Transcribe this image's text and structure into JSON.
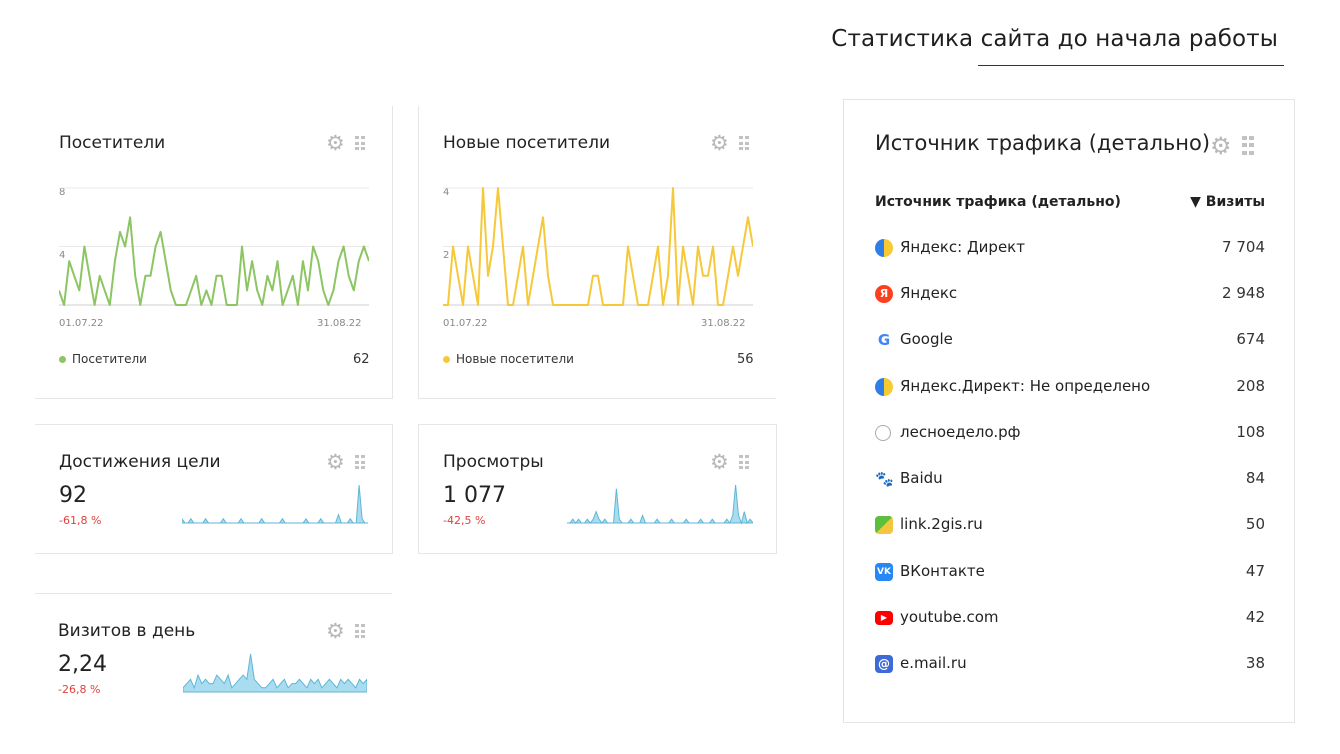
{
  "page": {
    "title": "Статистика сайта до начала работы"
  },
  "widgets": {
    "visitors": {
      "title": "Посетители",
      "y_ticks": [
        "8",
        "4"
      ],
      "x_start": "01.07.22",
      "x_end": "31.08.22",
      "legend_label": "Посетители",
      "legend_value": "62",
      "color": "#8cc563"
    },
    "new_visitors": {
      "title": "Новые посетители",
      "y_ticks": [
        "4",
        "2"
      ],
      "x_start": "01.07.22",
      "x_end": "31.08.22",
      "legend_label": "Новые посетители",
      "legend_value": "56",
      "color": "#f5c93a"
    },
    "goals": {
      "title": "Достижения цели",
      "value": "92",
      "change": "-61,8 %"
    },
    "views": {
      "title": "Просмотры",
      "value": "1 077",
      "change": "-42,5 %"
    },
    "visits_per_day": {
      "title": "Визитов в день",
      "value": "2,24",
      "change": "-26,8 %"
    }
  },
  "traffic": {
    "title": "Источник трафика (детально)",
    "col_source": "Источник трафика (детально)",
    "col_visits": "▼ Визиты",
    "rows": [
      {
        "name": "Яндекс: Директ",
        "value": "7 704",
        "icon": "yandex-direct-icon"
      },
      {
        "name": "Яндекс",
        "value": "2 948",
        "icon": "yandex-icon"
      },
      {
        "name": "Google",
        "value": "674",
        "icon": "google-icon"
      },
      {
        "name": "Яндекс.Директ: Не определено",
        "value": "208",
        "icon": "yandex-direct-icon"
      },
      {
        "name": "лесноеделo.рф",
        "value": "108",
        "icon": "globe-icon"
      },
      {
        "name": "Baidu",
        "value": "84",
        "icon": "baidu-icon"
      },
      {
        "name": "link.2gis.ru",
        "value": "50",
        "icon": "2gis-icon"
      },
      {
        "name": "ВКонтакте",
        "value": "47",
        "icon": "vk-icon"
      },
      {
        "name": "youtube.com",
        "value": "42",
        "icon": "youtube-icon"
      },
      {
        "name": "e.mail.ru",
        "value": "38",
        "icon": "mail-icon"
      }
    ]
  },
  "chart_data": [
    {
      "type": "line",
      "series": [
        {
          "name": "Посетители",
          "values": [
            1,
            0,
            3,
            2,
            1,
            4,
            2,
            0,
            2,
            1,
            0,
            3,
            5,
            4,
            6,
            2,
            0,
            2,
            2,
            4,
            5,
            3,
            1,
            0,
            0,
            0,
            1,
            2,
            0,
            1,
            0,
            2,
            2,
            0,
            0,
            0,
            4,
            1,
            3,
            1,
            0,
            2,
            1,
            3,
            0,
            1,
            2,
            0,
            3,
            1,
            4,
            3,
            1,
            0,
            1,
            3,
            4,
            2,
            1,
            3,
            4,
            3
          ]
        }
      ],
      "x_start": "01.07.22",
      "x_end": "31.08.22",
      "ylim": [
        0,
        8
      ]
    },
    {
      "type": "line",
      "series": [
        {
          "name": "Новые посетители",
          "values": [
            0,
            0,
            2,
            1,
            0,
            2,
            1,
            0,
            4,
            1,
            2,
            4,
            2,
            0,
            0,
            1,
            2,
            0,
            1,
            2,
            3,
            1,
            0,
            0,
            0,
            0,
            0,
            0,
            0,
            0,
            1,
            1,
            0,
            0,
            0,
            0,
            0,
            2,
            1,
            0,
            0,
            0,
            1,
            2,
            0,
            1,
            4,
            0,
            2,
            1,
            0,
            2,
            1,
            1,
            2,
            0,
            0,
            1,
            2,
            1,
            2,
            3,
            2
          ]
        }
      ],
      "x_start": "01.07.22",
      "x_end": "31.08.22",
      "ylim": [
        0,
        4
      ]
    },
    {
      "type": "area",
      "values": [
        1,
        0,
        0,
        1,
        0,
        0,
        0,
        0,
        1,
        0,
        0,
        0,
        0,
        0,
        1,
        0,
        0,
        0,
        0,
        0,
        1,
        0,
        0,
        0,
        0,
        0,
        0,
        1,
        0,
        0,
        0,
        0,
        0,
        0,
        1,
        0,
        0,
        0,
        0,
        0,
        0,
        0,
        1,
        0,
        0,
        0,
        0,
        1,
        0,
        0,
        0,
        0,
        0,
        2,
        0,
        0,
        0,
        1,
        0,
        0,
        9,
        1,
        0,
        0
      ]
    },
    {
      "type": "area",
      "values": [
        0,
        0,
        1,
        0,
        1,
        0,
        0,
        1,
        0,
        1,
        3,
        1,
        0,
        1,
        0,
        0,
        0,
        9,
        1,
        0,
        0,
        0,
        1,
        0,
        0,
        0,
        2,
        0,
        0,
        0,
        0,
        1,
        0,
        0,
        0,
        0,
        1,
        0,
        0,
        0,
        0,
        1,
        0,
        0,
        0,
        0,
        1,
        0,
        0,
        0,
        1,
        0,
        0,
        0,
        0,
        1,
        0,
        2,
        10,
        2,
        0,
        3,
        0,
        1,
        0
      ]
    },
    {
      "type": "area",
      "values": [
        1,
        2,
        3,
        1,
        4,
        2,
        3,
        2,
        2,
        4,
        3,
        2,
        4,
        1,
        2,
        3,
        4,
        3,
        9,
        3,
        2,
        1,
        1,
        2,
        3,
        1,
        2,
        3,
        1,
        2,
        2,
        3,
        2,
        1,
        3,
        2,
        3,
        1,
        2,
        3,
        2,
        1,
        3,
        2,
        3,
        2,
        1,
        3,
        2,
        3
      ]
    }
  ]
}
